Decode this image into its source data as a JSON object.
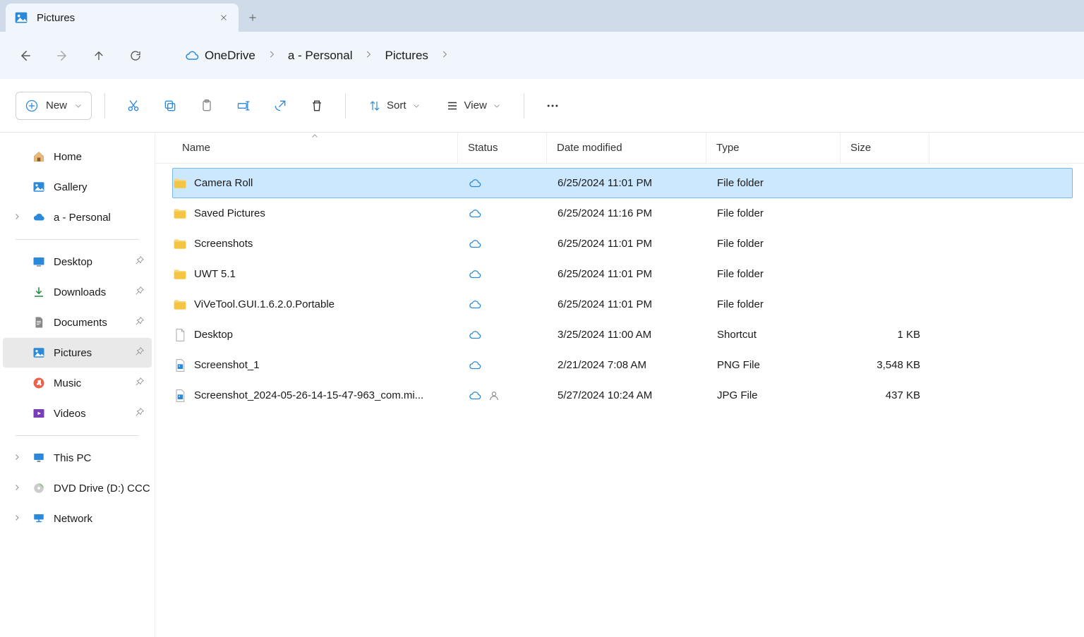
{
  "tab": {
    "title": "Pictures"
  },
  "breadcrumb": [
    "OneDrive",
    "a - Personal",
    "Pictures"
  ],
  "toolbar": {
    "new": "New",
    "sort": "Sort",
    "view": "View"
  },
  "columns": {
    "name": "Name",
    "status": "Status",
    "date": "Date modified",
    "type": "Type",
    "size": "Size"
  },
  "sidebar": {
    "top": [
      {
        "label": "Home"
      },
      {
        "label": "Gallery"
      },
      {
        "label": "a - Personal"
      }
    ],
    "pinned": [
      {
        "label": "Desktop"
      },
      {
        "label": "Downloads"
      },
      {
        "label": "Documents"
      },
      {
        "label": "Pictures"
      },
      {
        "label": "Music"
      },
      {
        "label": "Videos"
      }
    ],
    "bottom": [
      {
        "label": "This PC"
      },
      {
        "label": "DVD Drive (D:) CCC"
      },
      {
        "label": "Network"
      }
    ]
  },
  "rows": [
    {
      "name": "Camera Roll",
      "icon": "folder",
      "status": "cloud",
      "date": "6/25/2024 11:01 PM",
      "type": "File folder",
      "size": "",
      "selected": true
    },
    {
      "name": "Saved Pictures",
      "icon": "folder",
      "status": "cloud",
      "date": "6/25/2024 11:16 PM",
      "type": "File folder",
      "size": ""
    },
    {
      "name": "Screenshots",
      "icon": "folder",
      "status": "cloud",
      "date": "6/25/2024 11:01 PM",
      "type": "File folder",
      "size": ""
    },
    {
      "name": "UWT 5.1",
      "icon": "folder",
      "status": "cloud",
      "date": "6/25/2024 11:01 PM",
      "type": "File folder",
      "size": ""
    },
    {
      "name": "ViVeTool.GUI.1.6.2.0.Portable",
      "icon": "folder",
      "status": "cloud",
      "date": "6/25/2024 11:01 PM",
      "type": "File folder",
      "size": ""
    },
    {
      "name": "Desktop",
      "icon": "shortcut",
      "status": "cloud",
      "date": "3/25/2024 11:00 AM",
      "type": "Shortcut",
      "size": "1 KB"
    },
    {
      "name": "Screenshot_1",
      "icon": "image",
      "status": "cloud",
      "date": "2/21/2024 7:08 AM",
      "type": "PNG File",
      "size": "3,548 KB"
    },
    {
      "name": "Screenshot_2024-05-26-14-15-47-963_com.mi...",
      "icon": "image",
      "status": "cloud-shared",
      "date": "5/27/2024 10:24 AM",
      "type": "JPG File",
      "size": "437 KB"
    }
  ]
}
